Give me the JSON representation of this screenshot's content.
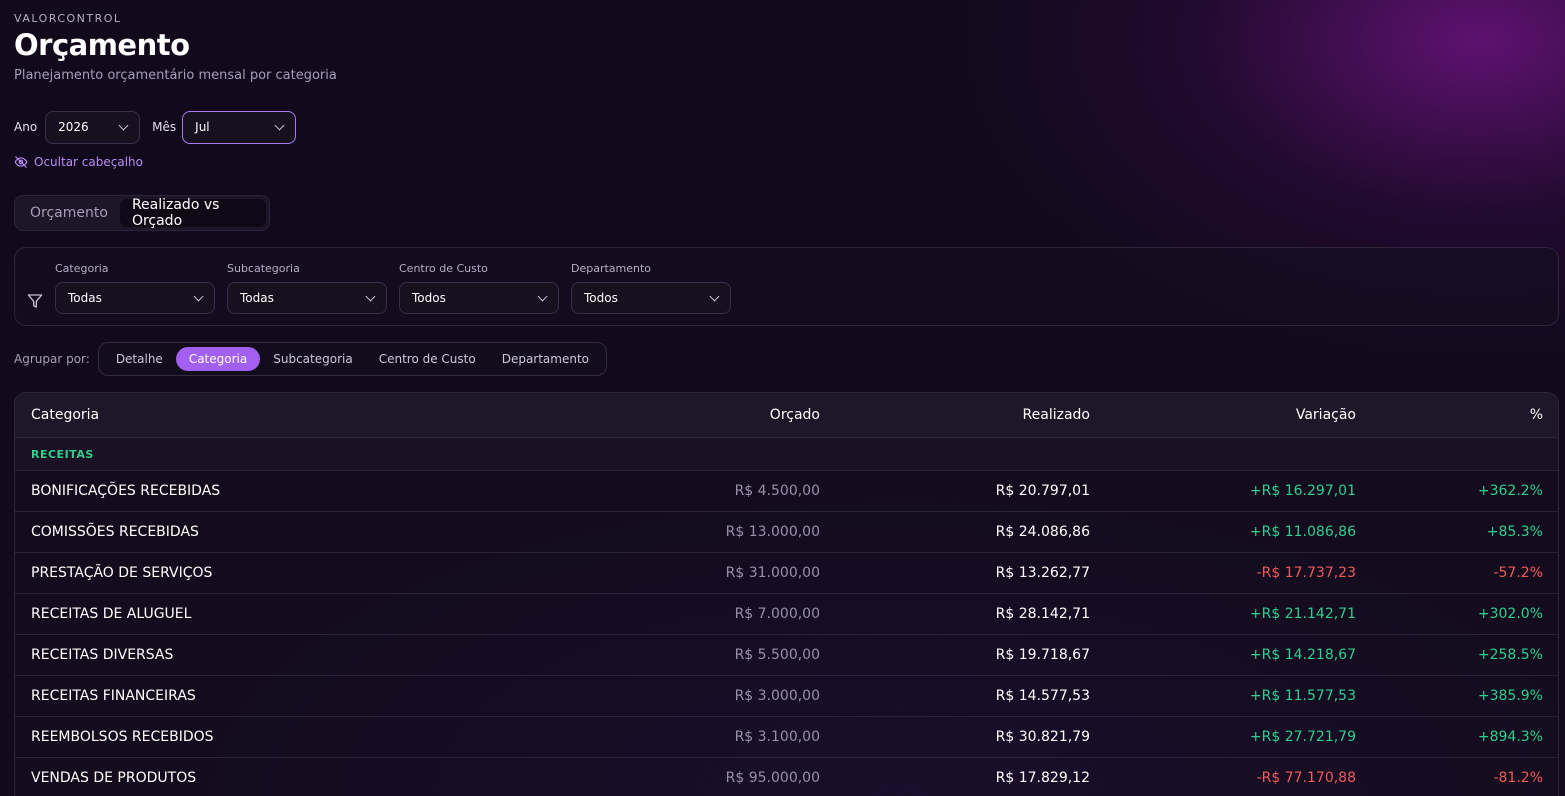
{
  "header": {
    "brand": "VALORCONTROL",
    "title": "Orçamento",
    "subtitle": "Planejamento orçamentário mensal por categoria"
  },
  "period": {
    "year_label": "Ano",
    "year_value": "2026",
    "month_label": "Mês",
    "month_value": "Jul"
  },
  "hide_header_label": "Ocultar cabeçalho",
  "tabs": [
    {
      "label": "Orçamento",
      "active": false
    },
    {
      "label": "Realizado vs Orçado",
      "active": true
    }
  ],
  "filters": [
    {
      "label": "Categoria",
      "value": "Todas"
    },
    {
      "label": "Subcategoria",
      "value": "Todas"
    },
    {
      "label": "Centro de Custo",
      "value": "Todos"
    },
    {
      "label": "Departamento",
      "value": "Todos"
    }
  ],
  "group_by": {
    "label": "Agrupar por:",
    "options": [
      {
        "label": "Detalhe",
        "active": false
      },
      {
        "label": "Categoria",
        "active": true
      },
      {
        "label": "Subcategoria",
        "active": false
      },
      {
        "label": "Centro de Custo",
        "active": false
      },
      {
        "label": "Departamento",
        "active": false
      }
    ]
  },
  "table": {
    "columns": [
      "Categoria",
      "Orçado",
      "Realizado",
      "Variação",
      "%"
    ],
    "section": "RECEITAS",
    "rows": [
      {
        "category": "BONIFICAÇÕES RECEBIDAS",
        "budget": "R$ 4.500,00",
        "actual": "R$ 20.797,01",
        "variance": "+R$ 16.297,01",
        "pct": "+362.2%",
        "trend": "pos"
      },
      {
        "category": "COMISSÕES RECEBIDAS",
        "budget": "R$ 13.000,00",
        "actual": "R$ 24.086,86",
        "variance": "+R$ 11.086,86",
        "pct": "+85.3%",
        "trend": "pos"
      },
      {
        "category": "PRESTAÇÃO DE SERVIÇOS",
        "budget": "R$ 31.000,00",
        "actual": "R$ 13.262,77",
        "variance": "-R$ 17.737,23",
        "pct": "-57.2%",
        "trend": "neg"
      },
      {
        "category": "RECEITAS DE ALUGUEL",
        "budget": "R$ 7.000,00",
        "actual": "R$ 28.142,71",
        "variance": "+R$ 21.142,71",
        "pct": "+302.0%",
        "trend": "pos"
      },
      {
        "category": "RECEITAS DIVERSAS",
        "budget": "R$ 5.500,00",
        "actual": "R$ 19.718,67",
        "variance": "+R$ 14.218,67",
        "pct": "+258.5%",
        "trend": "pos"
      },
      {
        "category": "RECEITAS FINANCEIRAS",
        "budget": "R$ 3.000,00",
        "actual": "R$ 14.577,53",
        "variance": "+R$ 11.577,53",
        "pct": "+385.9%",
        "trend": "pos"
      },
      {
        "category": "REEMBOLSOS RECEBIDOS",
        "budget": "R$ 3.100,00",
        "actual": "R$ 30.821,79",
        "variance": "+R$ 27.721,79",
        "pct": "+894.3%",
        "trend": "pos"
      },
      {
        "category": "VENDAS DE PRODUTOS",
        "budget": "R$ 95.000,00",
        "actual": "R$ 17.829,12",
        "variance": "-R$ 77.170,88",
        "pct": "-81.2%",
        "trend": "neg"
      }
    ]
  },
  "colors": {
    "accent": "#a35ff0",
    "positive": "#2ecf8f",
    "negative": "#f05a5a",
    "background": "#120a1c"
  },
  "icons": [
    "eye-off-icon",
    "filter-icon",
    "chevron-down-icon"
  ]
}
